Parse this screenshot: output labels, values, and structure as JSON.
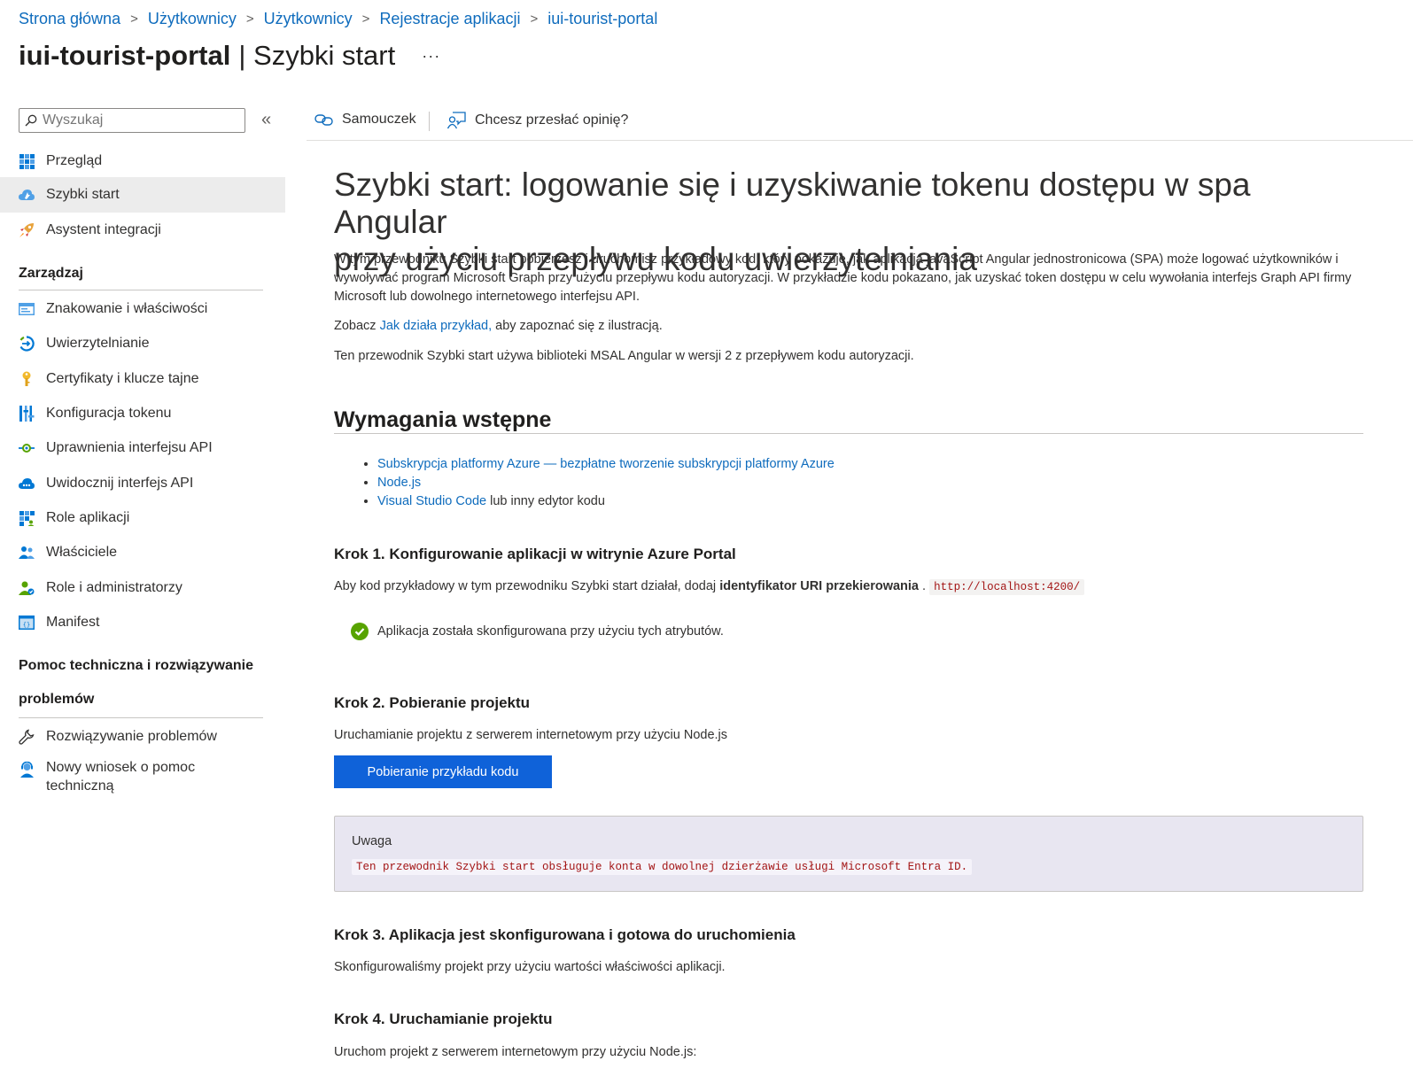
{
  "breadcrumb": [
    "Strona główna",
    "Użytkownicy",
    "Użytkownicy",
    "Rejestracje aplikacji",
    "iui-tourist-portal"
  ],
  "header": {
    "app_name": "iui-tourist-portal",
    "page_name": "| Szybki start",
    "more": "···"
  },
  "sidebar": {
    "search_placeholder": "Wyszukaj",
    "collapse": "«",
    "top_items": [
      {
        "label": "Przegląd",
        "icon": "overview-grid-icon"
      },
      {
        "label": "Szybki start",
        "icon": "quickstart-cloud-icon",
        "active": true
      },
      {
        "label": "Asystent integracji",
        "icon": "rocket-icon"
      }
    ],
    "manage_heading": "Zarządzaj",
    "manage_items": [
      {
        "label": "Znakowanie i właściwości",
        "icon": "branding-icon"
      },
      {
        "label": "Uwierzytelnianie",
        "icon": "authentication-icon"
      },
      {
        "label": "Certyfikaty i klucze tajne",
        "icon": "key-icon"
      },
      {
        "label": "Konfiguracja tokenu",
        "icon": "token-bars-icon"
      },
      {
        "label": "Uprawnienia interfejsu API",
        "icon": "api-permissions-icon"
      },
      {
        "label": "Uwidocznij interfejs API",
        "icon": "expose-api-cloud-icon"
      },
      {
        "label": "Role aplikacji",
        "icon": "app-roles-grid-icon"
      },
      {
        "label": "Właściciele",
        "icon": "owners-icon"
      },
      {
        "label": "Role i administratorzy",
        "icon": "roles-admins-icon"
      },
      {
        "label": "Manifest",
        "icon": "manifest-icon"
      }
    ],
    "support_heading_line1": "Pomoc techniczna i rozwiązywanie",
    "support_heading_line2": "problemów",
    "support_items": [
      {
        "label": "Rozwiązywanie problemów",
        "icon": "wrench-icon"
      },
      {
        "label_line1": "Nowy wniosek o pomoc",
        "label_line2": "techniczną",
        "icon": "support-person-icon"
      }
    ]
  },
  "toolbar": {
    "tutorial": "Samouczek",
    "feedback": "Chcesz przesłać opinię?"
  },
  "content": {
    "title_line1": "Szybki start: logowanie się i uzyskiwanie tokenu dostępu w spa Angular",
    "title_line2": "przy użyciu przepływu kodu uwierzytelniania",
    "intro": "W tym przewodniku Szybki start pobierzesz i uruchomisz przykładowy kod, który pokazuje, jak aplikacja javaScript Angular jednostronicowa (SPA) może logować użytkowników i wywoływać program Microsoft Graph przy użyciu przepływu kodu autoryzacji. W przykładzie kodu pokazano, jak uzyskać token dostępu w celu wywołania interfejs Graph API firmy Microsoft lub dowolnego internetowego interfejsu API.",
    "see_prefix": "Zobacz ",
    "see_link": "Jak działa przykład,",
    "see_suffix": " aby zapoznać się z ilustracją.",
    "msal_note": "Ten przewodnik Szybki start używa biblioteki MSAL Angular w wersji 2 z przepływem kodu autoryzacji.",
    "prereq_heading": "Wymagania wstępne",
    "prereq_1": "Subskrypcja platformy Azure — bezpłatne tworzenie subskrypcji platformy Azure",
    "prereq_2": "Node.js",
    "prereq_3_link": "Visual Studio Code",
    "prereq_3_text": " lub inny edytor kodu",
    "step1_heading": "Krok 1. Konfigurowanie aplikacji w witrynie Azure Portal",
    "step1_text": "Aby kod przykładowy w tym przewodniku Szybki start działał, dodaj ",
    "step1_bold": "identyfikator URI przekierowania",
    "step1_dot": " . ",
    "step1_code": "http://localhost:4200/",
    "step1_status": "Aplikacja została skonfigurowana przy użyciu tych atrybutów.",
    "step2_heading": "Krok 2. Pobieranie projektu",
    "step2_text": "Uruchamianie projektu z serwerem internetowym przy użyciu Node.js",
    "download_button": "Pobieranie przykładu kodu",
    "note_title": "Uwaga",
    "note_code": "Ten przewodnik Szybki start obsługuje konta w dowolnej dzierżawie usługi Microsoft Entra ID.",
    "step3_heading": "Krok 3. Aplikacja jest skonfigurowana i gotowa do uruchomienia",
    "step3_text": "Skonfigurowaliśmy projekt przy użyciu wartości właściwości aplikacji.",
    "step4_heading": "Krok 4. Uruchamianie projektu",
    "step4_text": "Uruchom projekt z serwerem internetowym przy użyciu Node.js:"
  },
  "colors": {
    "link": "#0f6cbd",
    "button": "#0f62d9",
    "note_bg": "#e8e6f1",
    "success": "#57a300",
    "code_text": "#a31515"
  }
}
